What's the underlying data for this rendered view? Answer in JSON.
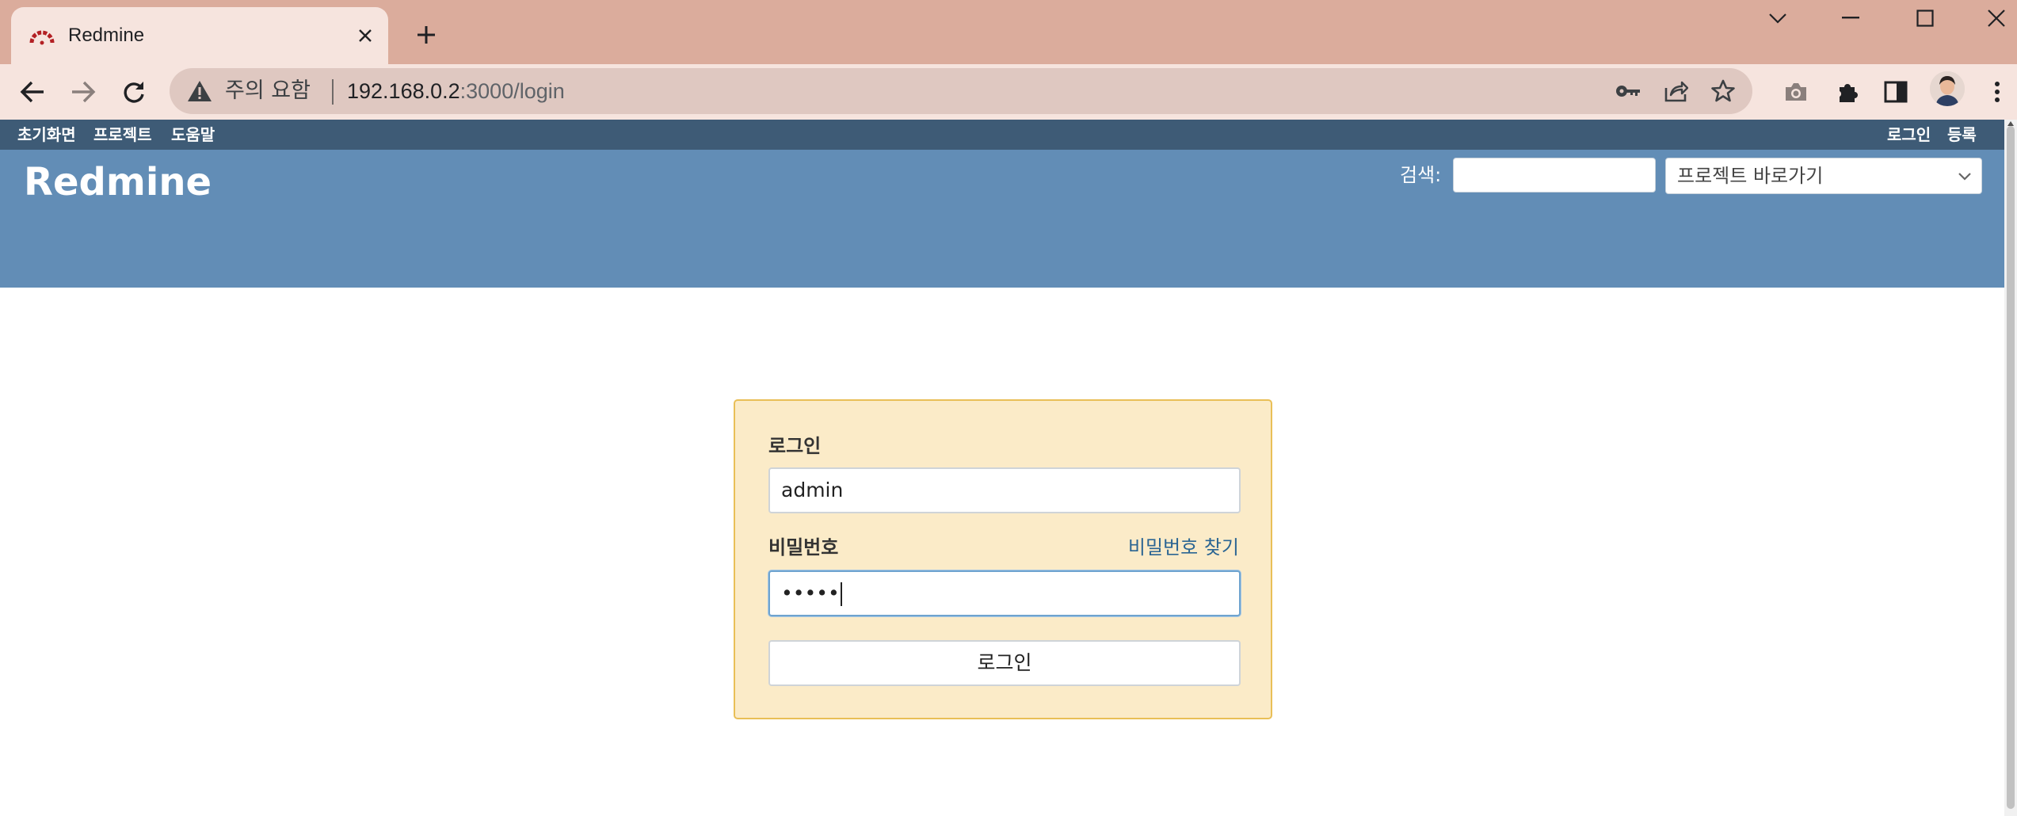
{
  "browser": {
    "tab_title": "Redmine",
    "security_label": "주의 요함",
    "url_host": "192.168.0.2",
    "url_path": ":3000/login"
  },
  "topmenu": {
    "left": [
      "초기화면",
      "프로젝트",
      "도움말"
    ],
    "right": [
      "로그인",
      "등록"
    ]
  },
  "header": {
    "title": "Redmine",
    "search_label": "검색:",
    "jump_placeholder": "프로젝트 바로가기"
  },
  "login": {
    "username_label": "로그인",
    "username_value": "admin",
    "password_label": "비밀번호",
    "password_masked": "•••••",
    "lost_password": "비밀번호 찾기",
    "submit_label": "로그인"
  },
  "colors": {
    "titlebar": "#dbac9c",
    "toolbar": "#f6e4de",
    "topmenu": "#3e5b76",
    "header": "#628db6",
    "login_bg": "#fbebc8",
    "login_border": "#e9bf57"
  },
  "icons": [
    "redmine-favicon",
    "close-icon",
    "plus-icon",
    "chevron-down-icon",
    "minimize-icon",
    "maximize-icon",
    "window-close-icon",
    "back-arrow-icon",
    "forward-arrow-icon",
    "reload-icon",
    "warning-icon",
    "key-icon",
    "share-icon",
    "star-icon",
    "camera-icon",
    "extensions-icon",
    "side-panel-icon",
    "profile-avatar",
    "more-vert-icon"
  ]
}
